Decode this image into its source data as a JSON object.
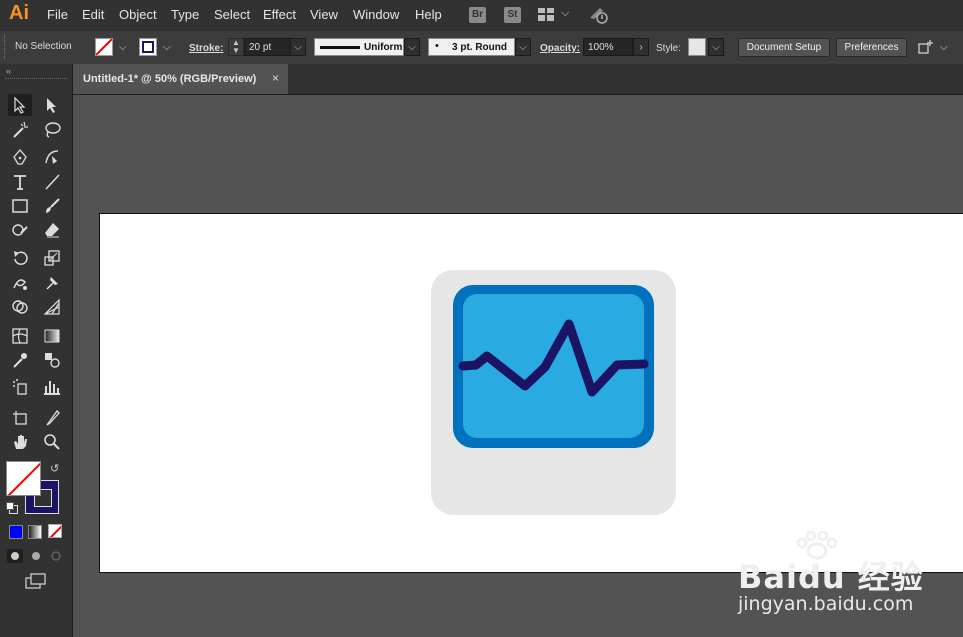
{
  "app": {
    "logo": "Ai"
  },
  "menu": [
    "File",
    "Edit",
    "Object",
    "Type",
    "Select",
    "Effect",
    "View",
    "Window",
    "Help"
  ],
  "menu_badges": {
    "bridge": "Br",
    "stock": "St"
  },
  "control_bar": {
    "selection_status": "No Selection",
    "stroke_label": "Stroke:",
    "stroke_value": "20 pt",
    "profile_value": "Uniform",
    "brush_value": "3 pt. Round",
    "opacity_label": "Opacity:",
    "opacity_value": "100%",
    "style_label": "Style:",
    "document_setup_label": "Document Setup",
    "preferences_label": "Preferences"
  },
  "document_tab": {
    "title": "Untitled-1* @ 50% (RGB/Preview)",
    "close": "×"
  },
  "colors": {
    "stroke_swatch": "#1b1464",
    "icon_background": "#e6e6e6",
    "monitor_frame": "#0071bc",
    "monitor_screen": "#29abe2",
    "pulse_line": "#1b1464"
  },
  "watermark": {
    "brand": "Baidu 经验",
    "url": "jingyan.baidu.com"
  }
}
